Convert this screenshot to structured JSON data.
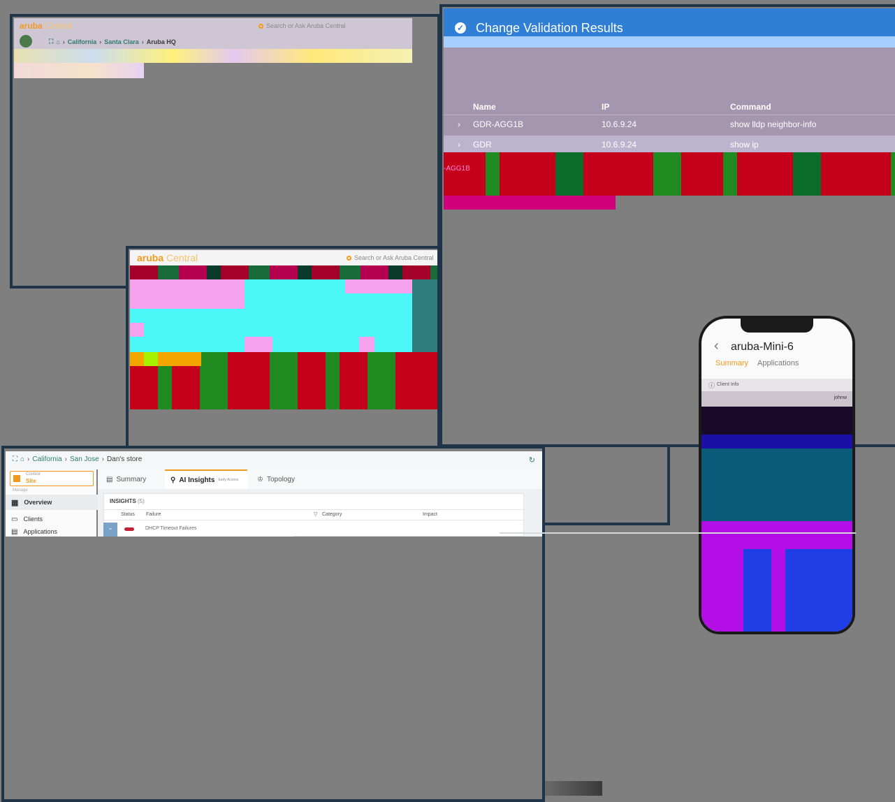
{
  "window1": {
    "brand": "aruba",
    "brand_suffix": "Central",
    "search_placeholder": "Search or Ask Aruba Central",
    "breadcrumb": [
      "California",
      "Santa Clara",
      "Aruba HQ"
    ]
  },
  "window2": {
    "brand": "aruba",
    "brand_suffix": "Central",
    "search_placeholder": "Search or Ask Aruba Central"
  },
  "window3": {
    "title": "Change Validation Results",
    "columns": [
      "Name",
      "IP",
      "Command"
    ],
    "rows": [
      {
        "name": "GDR-AGG1B",
        "ip": "10.6.9.24",
        "command": "show lldp neighbor-info"
      },
      {
        "name": "GDR",
        "ip": "10.6.9.24",
        "command": "show ip"
      }
    ],
    "overlay_text": "-AGG1B"
  },
  "window4": {
    "breadcrumb": [
      "California",
      "San Jose",
      "Dan's store"
    ],
    "context_label": "Context",
    "context_value": "Site",
    "nav_section": "Manage",
    "nav": [
      {
        "label": "Overview",
        "icon": "grid-icon"
      },
      {
        "label": "Clients",
        "icon": "clients-icon"
      },
      {
        "label": "Applications",
        "icon": "apps-icon"
      }
    ],
    "tabs": [
      {
        "label": "Summary",
        "icon": "summary-icon"
      },
      {
        "label": "AI Insights",
        "icon": "bulb-icon",
        "badge": "Early Access"
      },
      {
        "label": "Topology",
        "icon": "topology-icon"
      }
    ],
    "insights_title": "INSIGHTS",
    "insights_count": "(5)",
    "columns": [
      "Status",
      "Failure",
      "Category",
      "Impact"
    ],
    "row_failure": "DHCP Timeout Failures"
  },
  "phone": {
    "title": "aruba-Mini-6",
    "tabs": [
      "Summary",
      "Applications"
    ],
    "section": "Client Info",
    "user": "johnw"
  },
  "colors": {
    "frame": "#1f3447",
    "accent_orange": "#f39a1d",
    "link_green": "#2f7d6d",
    "header_blue": "#2f7fd6"
  }
}
